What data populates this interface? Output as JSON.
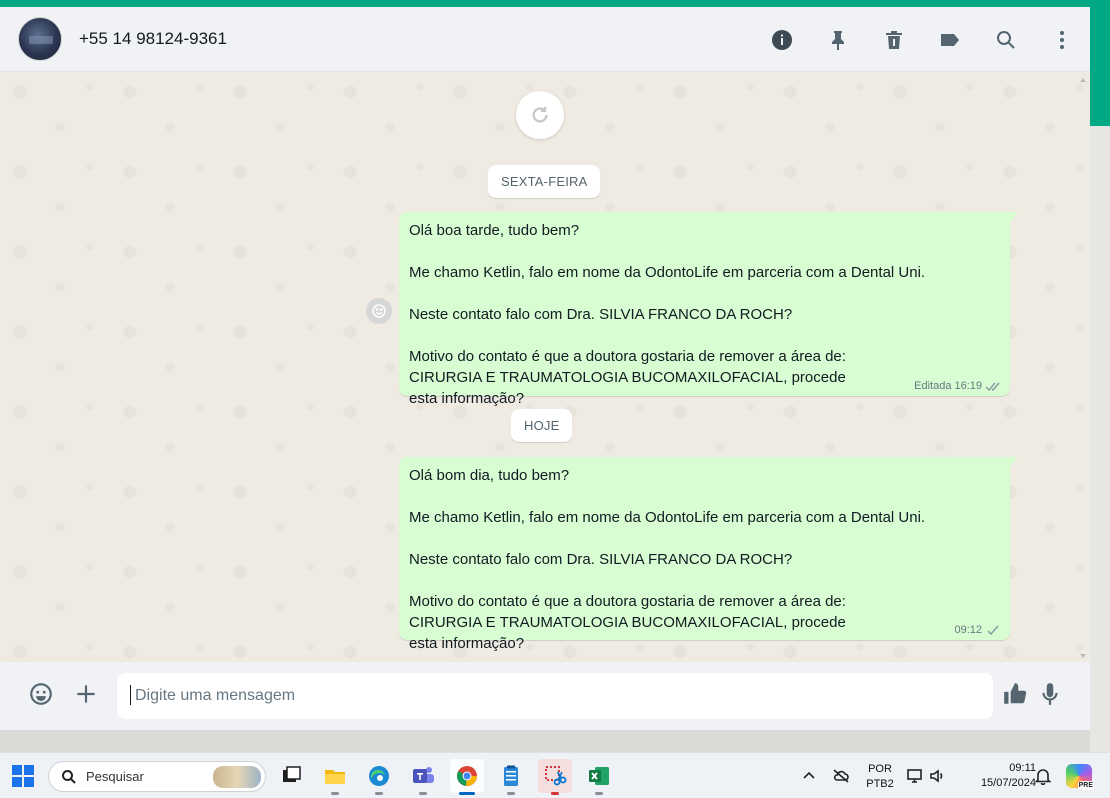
{
  "header": {
    "contact_name": "+55 14 98124-9361",
    "icons": [
      "info-icon",
      "pin-icon",
      "delete-icon",
      "label-icon",
      "search-icon",
      "menu-icon"
    ]
  },
  "chat": {
    "date_separators": [
      "SEXTA-FEIRA",
      "HOJE"
    ],
    "messages": [
      {
        "lines": [
          "Olá boa tarde, tudo bem?",
          "Me chamo Ketlin, falo em nome da OdontoLife em parceria com a Dental Uni.",
          "Neste contato falo com Dra. SILVIA FRANCO DA ROCH?",
          "Motivo do contato é que a doutora gostaria de remover a área de: CIRURGIA E TRAUMATOLOGIA BUCOMAXILOFACIAL, procede esta informação?"
        ],
        "edited_label": "Editada",
        "time": "16:19",
        "status": "delivered-double-check"
      },
      {
        "lines": [
          "Olá bom dia, tudo bem?",
          "Me chamo Ketlin, falo em nome da OdontoLife em parceria com a Dental Uni.",
          "Neste contato falo com Dra. SILVIA FRANCO DA ROCH?",
          "Motivo do contato é que a doutora gostaria de remover a área de: CIRURGIA E TRAUMATOLOGIA BUCOMAXILOFACIAL, procede esta informação?"
        ],
        "time": "09:12",
        "status": "sent-single-check"
      }
    ]
  },
  "composer": {
    "placeholder": "Digite uma mensagem"
  },
  "taskbar": {
    "search_label": "Pesquisar",
    "language": "POR",
    "keyboard": "PTB2",
    "time": "09:11",
    "date": "15/07/2024",
    "copilot_badge": "PRE"
  },
  "colors": {
    "accent": "#00a884",
    "outgoing_bubble": "#d9fdd3",
    "header_bg": "#f0f2f5",
    "chat_bg": "#efeae2"
  }
}
